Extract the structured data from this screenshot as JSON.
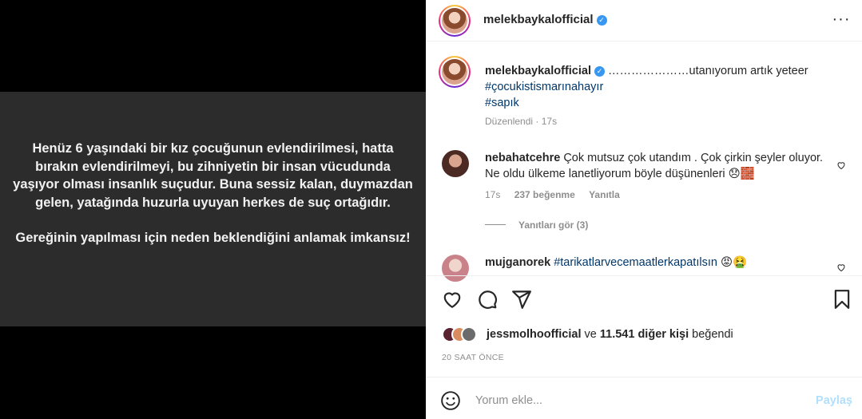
{
  "media": {
    "paragraph1": "Henüz 6 yaşındaki bir kız çocuğunun evlendirilmesi, hatta bırakın evlendirilmeyi, bu zihniyetin bir insan vücudunda yaşıyor olması insanlık suçudur. Buna sessiz kalan, duymazdan gelen, yatağında huzurla uyuyan herkes de suç ortağıdır.",
    "paragraph2": "Gereğinin yapılması için neden beklendiğini anlamak imkansız!"
  },
  "header": {
    "username": "melekbaykalofficial",
    "more_label": "···"
  },
  "caption": {
    "username": "melekbaykalofficial",
    "text": "…………………utanıyorum artık yeteer",
    "hashtags": [
      "#çocukistismarınahayır",
      "#sapık"
    ],
    "edited": "Düzenlendi",
    "time": "17s"
  },
  "comments": [
    {
      "username": "nebahatcehre",
      "text": "Çok mutsuz çok utandım . Çok çirkin şeyler oluyor. Ne oldu ülkeme lanetliyorum böyle düşünenleri 😞🧱",
      "time": "17s",
      "likes": "237 beğenme",
      "reply_label": "Yanıtla"
    },
    {
      "username": "mujganorek",
      "text": "#tarikatlarvecemaatlerkapatılsın",
      "emojis": "😡🤮"
    }
  ],
  "replies_label": "Yanıtları gör (3)",
  "likes": {
    "user": "jessmolhoofficial",
    "connector": "ve",
    "count": "11.541 diğer kişi",
    "suffix": "beğendi"
  },
  "timeago": "20 SAAT ÖNCE",
  "composer": {
    "placeholder": "Yorum ekle...",
    "post_label": "Paylaş"
  },
  "colors": {
    "link": "#00376b",
    "verified": "#3897f0",
    "muted": "#8e8e8e",
    "post_disabled": "#b2dffc"
  },
  "icons": {
    "like": "heart-icon",
    "comment": "comment-icon",
    "share": "share-icon",
    "save": "bookmark-icon",
    "emoji": "emoji-icon",
    "verified": "verified-badge-icon"
  }
}
